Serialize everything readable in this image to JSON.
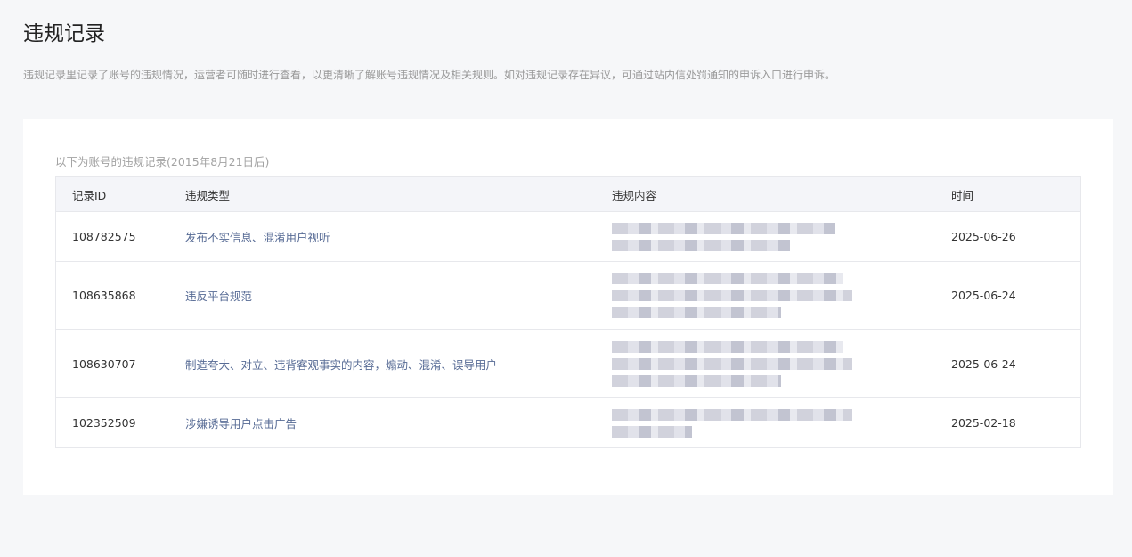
{
  "page": {
    "title": "违规记录",
    "description": "违规记录里记录了账号的违规情况，运营者可随时进行查看，以更清晰了解账号违规情况及相关规则。如对违规记录存在异议，可通过站内信处罚通知的申诉入口进行申诉。"
  },
  "records": {
    "caption": "以下为账号的违规记录(2015年8月21日后)",
    "headers": [
      "记录ID",
      "违规类型",
      "违规内容",
      "时间"
    ],
    "rows": [
      {
        "id": "108782575",
        "type": "发布不实信息、混淆用户视听",
        "date": "2025-06-26"
      },
      {
        "id": "108635868",
        "type": "违反平台规范",
        "date": "2025-06-24"
      },
      {
        "id": "108630707",
        "type": "制造夸大、对立、违背客观事实的内容，煽动、混淆、误导用户",
        "date": "2025-06-24"
      },
      {
        "id": "102352509",
        "type": "涉嫌诱导用户点击广告",
        "date": "2025-02-18"
      }
    ]
  },
  "colors": {
    "link": "#576b95",
    "header_bg": "#f4f5f9",
    "page_bg": "#f6f7f9"
  }
}
